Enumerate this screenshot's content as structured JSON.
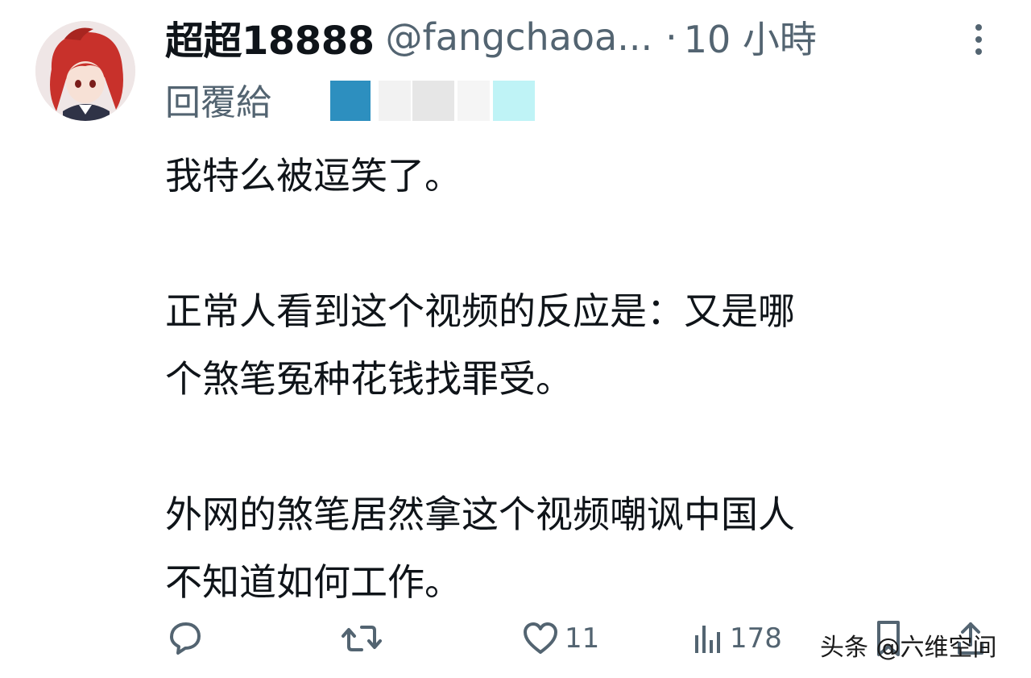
{
  "tweet": {
    "display_name": "超超18888",
    "handle": "@fangchaoa...",
    "separator": "·",
    "time": "10 小時",
    "reply_label": "回覆給",
    "paragraphs": [
      [
        "我特么被逗笑了。"
      ],
      [
        "正常人看到这个视频的反应是：又是哪",
        "个煞笔冤种花钱找罪受。"
      ],
      [
        "外网的煞笔居然拿这个视频嘲讽中国人",
        "不知道如何工作。"
      ]
    ]
  },
  "actions": {
    "reply_icon": "comment-bubble-icon",
    "retweet_icon": "retweet-icon",
    "like_icon": "heart-icon",
    "like_count": "11",
    "views_icon": "bar-chart-icon",
    "views_count": "178",
    "bookmark_icon": "bookmark-icon",
    "share_icon": "share-icon"
  },
  "watermark": "头条 @六维空间",
  "colors": {
    "text": "#0f1419",
    "secondary": "#536471",
    "avatar_hair": "#c8312b"
  }
}
